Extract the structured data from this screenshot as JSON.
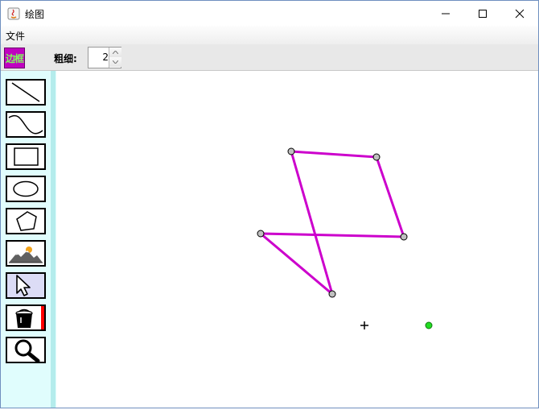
{
  "window": {
    "title": "绘图"
  },
  "menu": {
    "items": [
      "文件"
    ]
  },
  "options": {
    "border_label": "边框",
    "thickness_label": "粗细:",
    "thickness_value": "2"
  },
  "toolbox": {
    "tools": [
      {
        "name": "line",
        "icon": "line-tool-icon"
      },
      {
        "name": "curve",
        "icon": "curve-tool-icon"
      },
      {
        "name": "rectangle",
        "icon": "rectangle-tool-icon"
      },
      {
        "name": "ellipse",
        "icon": "ellipse-tool-icon"
      },
      {
        "name": "polygon",
        "icon": "polygon-tool-icon"
      },
      {
        "name": "image",
        "icon": "mountain-image-icon"
      },
      {
        "name": "select",
        "icon": "pointer-arrow-icon",
        "selected": true
      },
      {
        "name": "fill",
        "icon": "paint-bucket-icon"
      },
      {
        "name": "zoom",
        "icon": "magnifier-icon"
      }
    ]
  },
  "colors": {
    "star_stroke": "#cc00cc",
    "border_button_bg": "#c000c0",
    "border_button_text": "#7dff5a",
    "fill_color_swatch": "#ff0000",
    "vertex_handle": "#c0c0c0",
    "green_point": "#22dd22",
    "toolbox_bg": "#e0fdfd"
  }
}
